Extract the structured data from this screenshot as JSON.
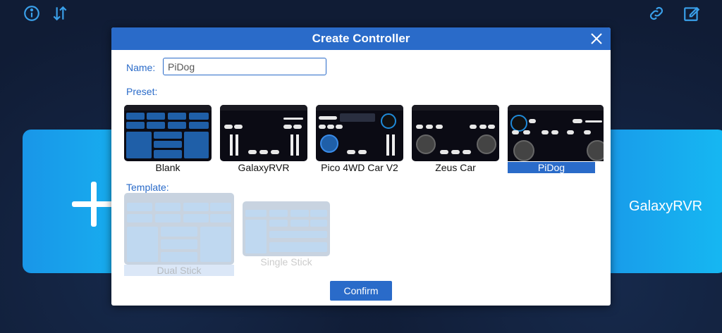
{
  "top_icons": {
    "left": [
      "info-icon",
      "sort-icon"
    ],
    "right": [
      "link-icon",
      "edit-icon"
    ]
  },
  "background": {
    "card_label": "GalaxyRVR"
  },
  "dialog": {
    "title": "Create Controller",
    "name_label": "Name:",
    "name_value": "PiDog",
    "preset_label": "Preset:",
    "presets": [
      {
        "label": "Blank"
      },
      {
        "label": "GalaxyRVR"
      },
      {
        "label": "Pico 4WD Car V2"
      },
      {
        "label": "Zeus Car"
      },
      {
        "label": "PiDog",
        "selected": true
      }
    ],
    "template_label": "Template:",
    "templates": [
      {
        "label": "Dual Stick",
        "selected": true
      },
      {
        "label": "Single Stick"
      }
    ],
    "confirm_label": "Confirm"
  },
  "colors": {
    "accent": "#2a6bc9",
    "background": "#101c35",
    "card": "#1996e8"
  }
}
